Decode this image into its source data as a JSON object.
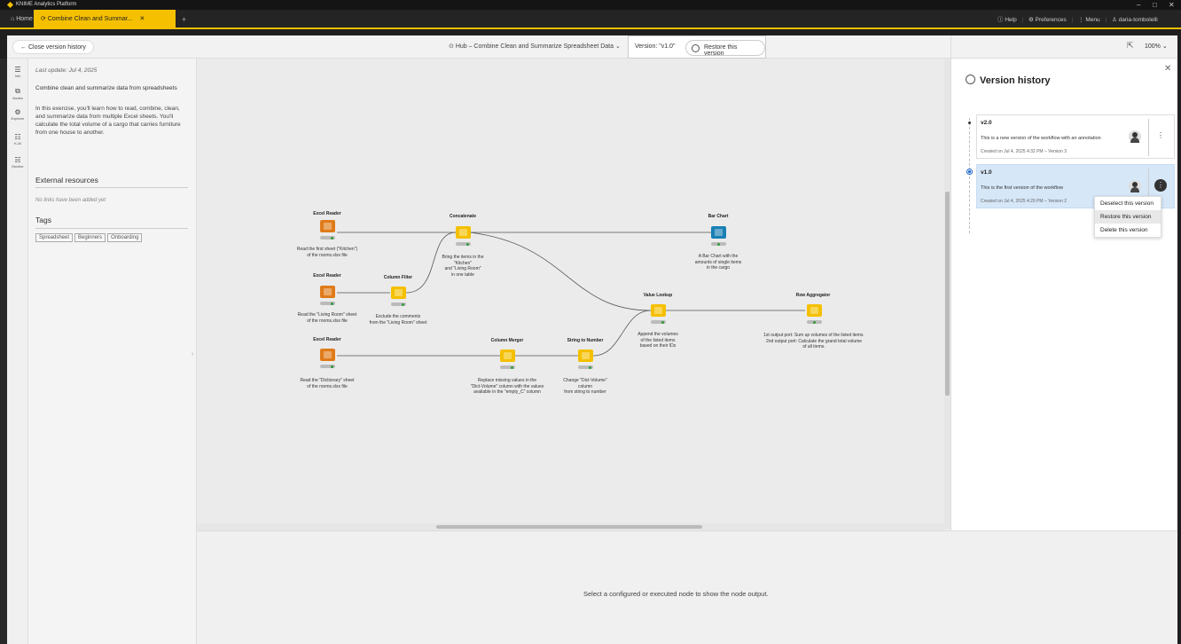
{
  "app": {
    "window_title": "KNIME Analytics Platform",
    "window_controls": [
      "–",
      "□",
      "✕"
    ]
  },
  "tabs": {
    "home": "Home",
    "active": "Combine Clean and Summar...",
    "add": "+"
  },
  "topbar": {
    "help": "Help",
    "preferences": "Preferences",
    "menu": "Menu",
    "user": "daria-tombolelli"
  },
  "header": {
    "close_version_history": "Close version history",
    "hub_path": "Hub – Combine Clean and Summarize Spreadsheet Data",
    "version_label": "Version: \"v1.0\"",
    "restore_button": "Restore this version"
  },
  "sidenav": {
    "items": [
      {
        "label": "Info",
        "icon": "info-icon"
      },
      {
        "label": "Nodes",
        "icon": "nodes-icon"
      },
      {
        "label": "Explorer",
        "icon": "explorer-icon"
      },
      {
        "label": "K-AI",
        "icon": "kai-icon"
      },
      {
        "label": "Monitor",
        "icon": "monitor-icon"
      }
    ]
  },
  "info": {
    "last_update": "Last update: Jul 4, 2025",
    "title": "Combine clean and summarize data from spreadsheets",
    "description": "In this exercise, you'll learn how to read, combine, clean, and summarize data from multiple Excel sheets. You'll calculate the total volume of a cargo that carries furniture from one house to another.",
    "external_resources_heading": "External resources",
    "no_links": "No links have been added yet",
    "tags_heading": "Tags",
    "tags": [
      "Spreadsheet",
      "Beginners",
      "Onboarding"
    ]
  },
  "nodes": [
    {
      "id": "excel1",
      "name": "Excel Reader",
      "color": "#e07b1a",
      "desc": [
        "Read the first sheet (\"Kitchen\")",
        "of the rooms.xlsx file"
      ]
    },
    {
      "id": "excel2",
      "name": "Excel Reader",
      "color": "#e07b1a",
      "desc": [
        "Read the \"Living Room\" sheet",
        "of the rooms.xlsx file"
      ]
    },
    {
      "id": "excel3",
      "name": "Excel Reader",
      "color": "#e07b1a",
      "desc": [
        "Read the \"Dictionary\" sheet",
        "of the rooms.xlsx file"
      ]
    },
    {
      "id": "colfilter",
      "name": "Column Filter",
      "color": "#f5c000",
      "desc": [
        "Exclude the comments",
        "from the \"Living Room\" sheet"
      ]
    },
    {
      "id": "concat",
      "name": "Concatenate",
      "color": "#f5c000",
      "desc": [
        "Bring the items in the",
        "\"Kitchen\"",
        "and \"Living Room\"",
        "in one table"
      ]
    },
    {
      "id": "barchart",
      "name": "Bar Chart",
      "color": "#1a7fb4",
      "desc": [
        "A Bar Chart with the",
        "amounts of single items",
        "in the cargo"
      ]
    },
    {
      "id": "valuelookup",
      "name": "Value Lookup",
      "color": "#f5c000",
      "desc": [
        "Append the volumes",
        "of the listed items",
        "based on their IDs"
      ]
    },
    {
      "id": "rowagg",
      "name": "Row Aggregator",
      "color": "#f5c000",
      "desc": [
        "1st output port: Sum up volumes of the listed items.",
        "2nd output port: Calculate the grand total volume",
        "of all items."
      ]
    },
    {
      "id": "colmerger",
      "name": "Column Merger",
      "color": "#f5c000",
      "desc": [
        "Replace missing values in the",
        "\"Dict-Volume\" column with the values",
        "available in the \"empty_C\" column"
      ]
    },
    {
      "id": "str2num",
      "name": "String to Number",
      "color": "#f5c000",
      "desc": [
        "Change \"Dict-Volume\"",
        "column",
        "from string to number"
      ]
    }
  ],
  "output": {
    "message": "Select a configured or executed node to show the node output."
  },
  "right_panel": {
    "zoom": "100%",
    "title": "Version history",
    "versions": [
      {
        "label": "v2.0",
        "description": "This is a new version of the workflow with an annotation",
        "meta": "Created on Jul 4, 2025 4:32 PM – Version 3",
        "selected": false
      },
      {
        "label": "v1.0",
        "description": "This is the first version of the workflow",
        "meta": "Created on Jul 4, 2025 4:29 PM – Version 2",
        "selected": true
      }
    ],
    "context_menu": [
      "Deselect this version",
      "Restore this version",
      "Delete this version"
    ]
  },
  "colors": {
    "accent": "#f5c000",
    "selected_card": "#d6e7f8",
    "radio": "#1a63c7"
  }
}
